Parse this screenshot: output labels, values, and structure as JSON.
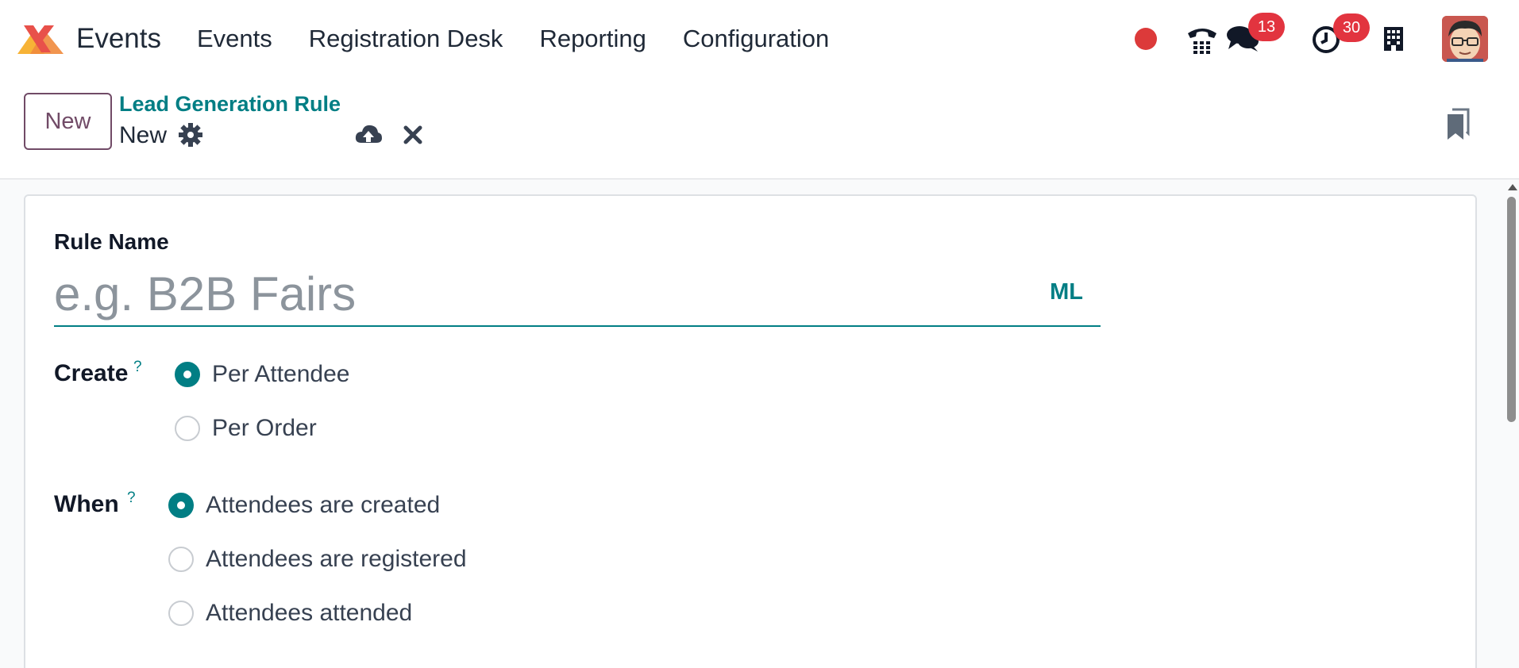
{
  "navbar": {
    "app_name": "Events",
    "menu": [
      {
        "label": "Events"
      },
      {
        "label": "Registration Desk"
      },
      {
        "label": "Reporting"
      },
      {
        "label": "Configuration"
      }
    ],
    "systray": {
      "messages_count": "13",
      "activities_count": "30"
    },
    "colors": {
      "brand_orange": "#f7b336",
      "brand_red": "#e8514a",
      "badge": "#e2343f"
    }
  },
  "control_panel": {
    "new_button": "New",
    "breadcrumb_parent": "Lead Generation Rule",
    "breadcrumb_current": "New"
  },
  "form": {
    "rule_name_label": "Rule Name",
    "rule_name_placeholder": "e.g. B2B Fairs",
    "rule_name_value": "",
    "lang_button": "ML",
    "create": {
      "label": "Create",
      "help": "?",
      "options": [
        {
          "label": "Per Attendee",
          "checked": true
        },
        {
          "label": "Per Order",
          "checked": false
        }
      ]
    },
    "when": {
      "label": "When",
      "help": "?",
      "options": [
        {
          "label": "Attendees are created",
          "checked": true
        },
        {
          "label": "Attendees are registered",
          "checked": false
        },
        {
          "label": "Attendees attended",
          "checked": false
        }
      ]
    }
  },
  "theme": {
    "accent": "#017e84",
    "primary": "#714b67"
  }
}
